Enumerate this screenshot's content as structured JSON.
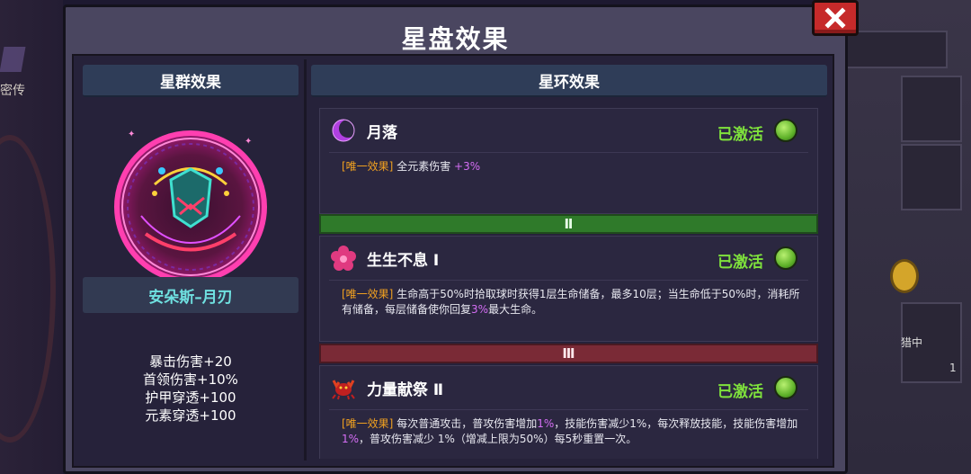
{
  "window": {
    "title": "星盘效果",
    "close_label": "✕"
  },
  "background": {
    "left_label": "密传",
    "right_small_1": "猎中",
    "right_small_2": "1"
  },
  "left": {
    "header": "星群效果",
    "constellation_name": "安朵斯–月刃",
    "stats": [
      "暴击伤害+20",
      "首领伤害+10%",
      "护甲穿透+100",
      "元素穿透+100"
    ]
  },
  "right": {
    "header": "星环效果",
    "effects": [
      {
        "name": "月落",
        "icon": "crescent-moon-icon",
        "status": "已激活",
        "tag": "[唯一效果]",
        "desc_parts": [
          " 全元素伤害 ",
          "+3%",
          ""
        ]
      },
      {
        "name": "生生不息 Ⅰ",
        "icon": "flower-icon",
        "status": "已激活",
        "tag": "[唯一效果]",
        "desc_parts": [
          " 生命高于50%时拾取球时获得1层生命储备，最多10层；当生命低于50%时，消耗所有储备，每层储备使你回复",
          "3%",
          "最大生命。"
        ]
      },
      {
        "name": "力量献祭 Ⅱ",
        "icon": "crab-demon-icon",
        "status": "已激活",
        "tag": "[唯一效果]",
        "desc_parts": [
          " 每次普通攻击，普攻伤害增加",
          "1%",
          "，技能伤害减少1%，每次释放技能，技能伤害增加",
          "1%",
          "，普攻伤害减少 1%（增减上限为50%）每5秒重置一次。"
        ]
      }
    ],
    "tiers": [
      "Ⅱ",
      "Ⅲ"
    ]
  },
  "colors": {
    "active_green": "#7fe23c",
    "tag_orange": "#f0a020",
    "highlight_purple": "#d56ef5",
    "name_cyan": "#6fe0e0",
    "tier2_green": "#2f7a2a",
    "tier3_red": "#7a2a36"
  }
}
